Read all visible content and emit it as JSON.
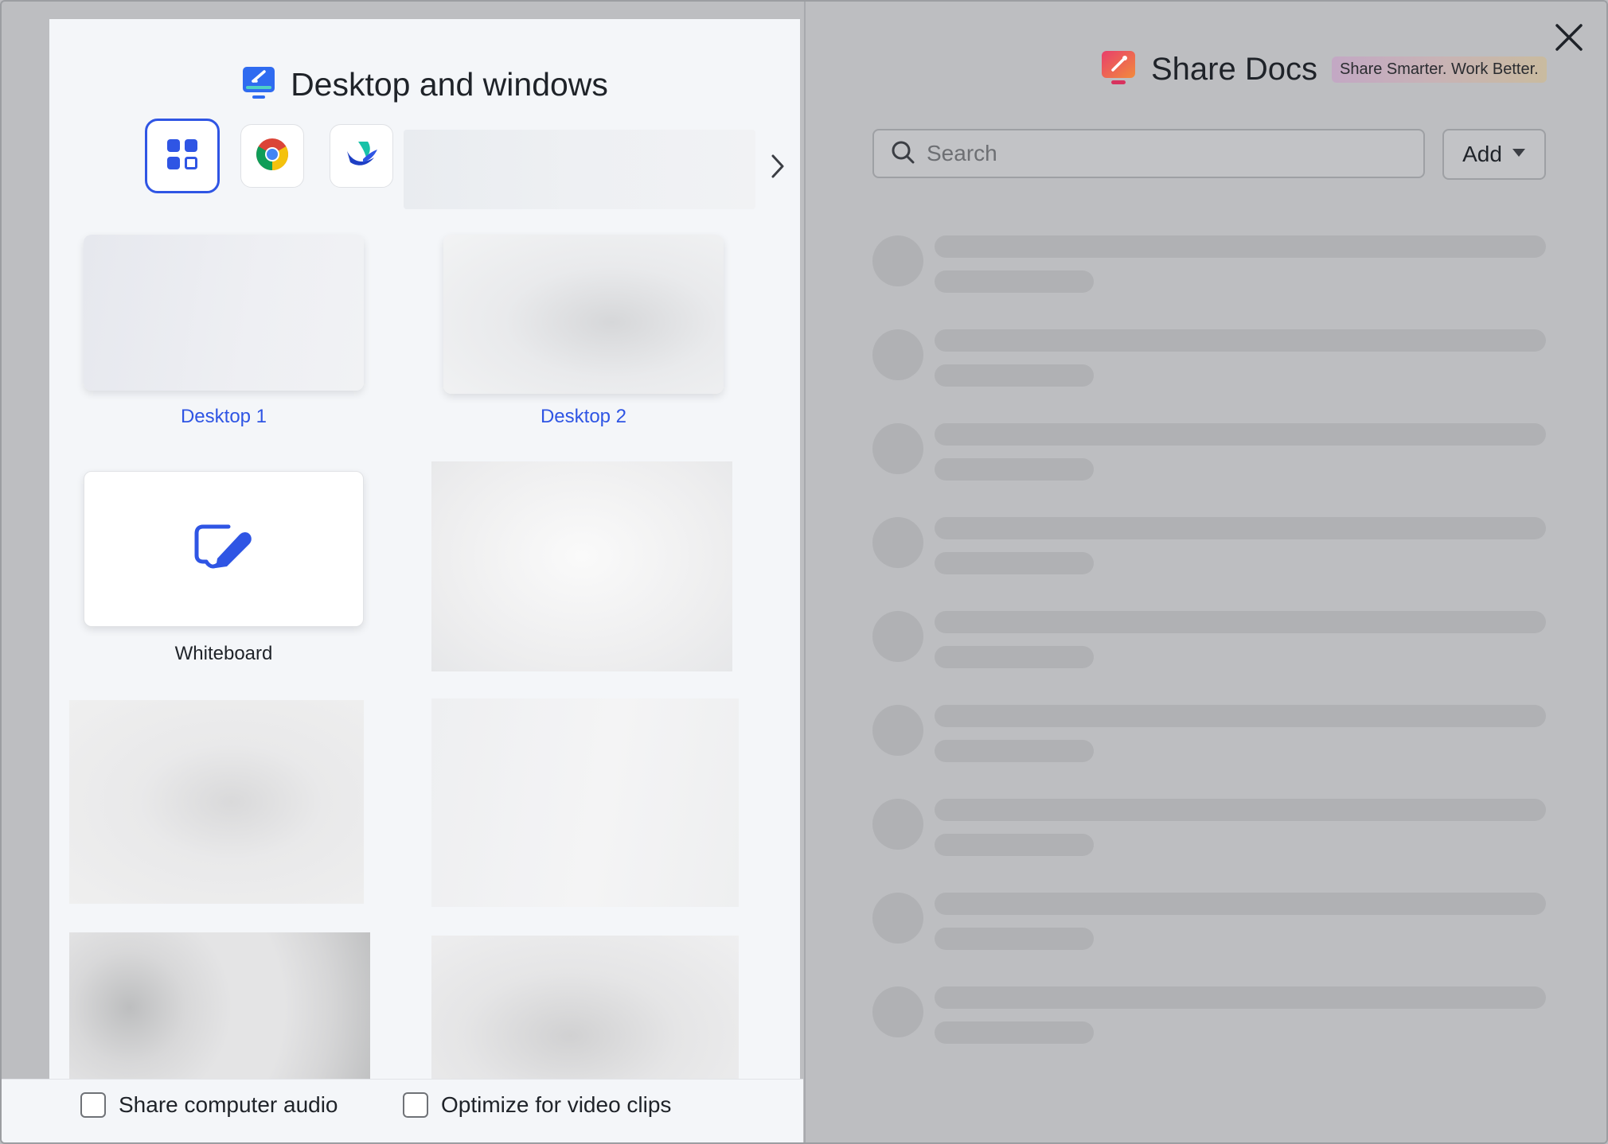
{
  "left": {
    "title": "Desktop and windows",
    "tabs": [
      {
        "name": "all-apps",
        "icon": "grid-icon"
      },
      {
        "name": "chrome",
        "icon": "chrome-icon"
      },
      {
        "name": "lark",
        "icon": "lark-icon"
      }
    ],
    "items": [
      {
        "label": "Desktop 1"
      },
      {
        "label": "Desktop 2"
      },
      {
        "label": "Whiteboard"
      }
    ],
    "options": {
      "share_audio": "Share computer audio",
      "optimize_video": "Optimize for video clips"
    }
  },
  "right": {
    "title": "Share Docs",
    "tagline": "Share Smarter. Work Better.",
    "search_placeholder": "Search",
    "add_label": "Add"
  },
  "colors": {
    "accent": "#2f55e4",
    "overlay": "#bdbec1",
    "panel": "#f4f6f9"
  }
}
